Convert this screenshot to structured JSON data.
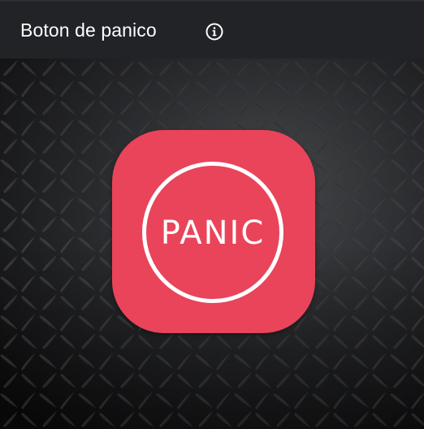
{
  "appbar": {
    "title": "Boton de panico",
    "info_icon": "info-circle-icon"
  },
  "background": {
    "texture": "diamond-plate-metal"
  },
  "panic_button": {
    "label": "PANIC"
  },
  "colors": {
    "appbar_bg": "#222327",
    "panic_red": "#e9445a",
    "text": "#ffffff"
  }
}
